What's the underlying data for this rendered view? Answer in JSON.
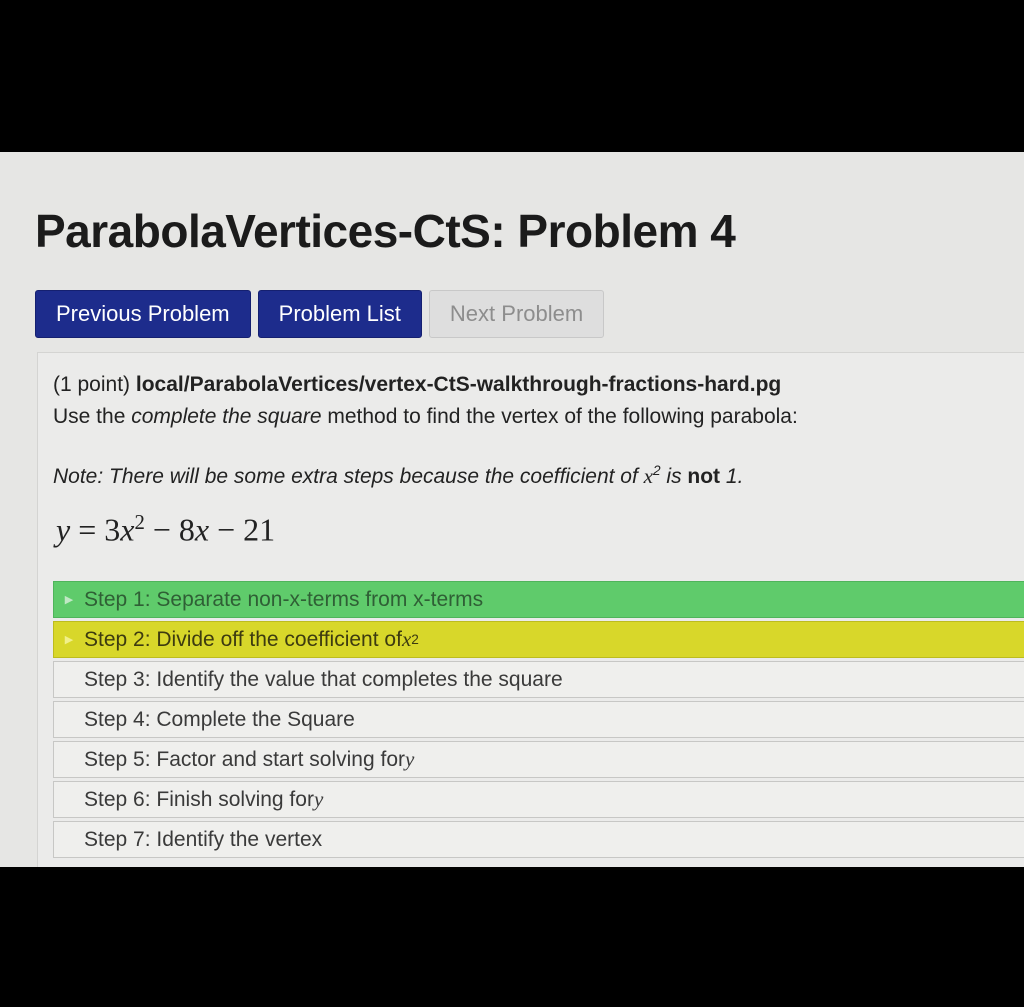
{
  "page": {
    "title": "ParabolaVertices-CtS: Problem 4"
  },
  "nav": {
    "previous_label": "Previous Problem",
    "list_label": "Problem List",
    "next_label": "Next Problem"
  },
  "problem": {
    "points": "(1 point)",
    "path": "local/ParabolaVertices/vertex-CtS-walkthrough-fractions-hard.pg",
    "instruction_before": "Use the ",
    "instruction_emph": "complete the square",
    "instruction_after": " method to find the vertex of the following parabola:",
    "note_before": "Note: There will be some extra steps because the coefficient of ",
    "note_var": "x",
    "note_exp": "2",
    "note_mid": " is ",
    "note_bold": "not",
    "note_after": " 1.",
    "equation": {
      "lhs": "y",
      "equals": " = ",
      "coef": "3",
      "var": "x",
      "exp": "2",
      "rest_before": " − 8",
      "rest_var": "x",
      "rest_after": " − 21"
    }
  },
  "steps": [
    {
      "label": "Step 1: Separate non-x-terms from x-terms",
      "state": "complete"
    },
    {
      "label": "Step 2: Divide off the coefficient of ",
      "math": "x",
      "exp": "2",
      "state": "active"
    },
    {
      "label": "Step 3: Identify the value that completes the square"
    },
    {
      "label": "Step 4: Complete the Square"
    },
    {
      "label": "Step 5: Factor and start solving for ",
      "math": "y"
    },
    {
      "label": "Step 6: Finish solving for ",
      "math": "y"
    },
    {
      "label": "Step 7: Identify the vertex"
    }
  ],
  "colors": {
    "primary_button": "#1d2c8c",
    "step_complete": "#5fcb6b",
    "step_active": "#d8d72a"
  },
  "icons": {
    "step_expander": "triangle-right-icon"
  }
}
